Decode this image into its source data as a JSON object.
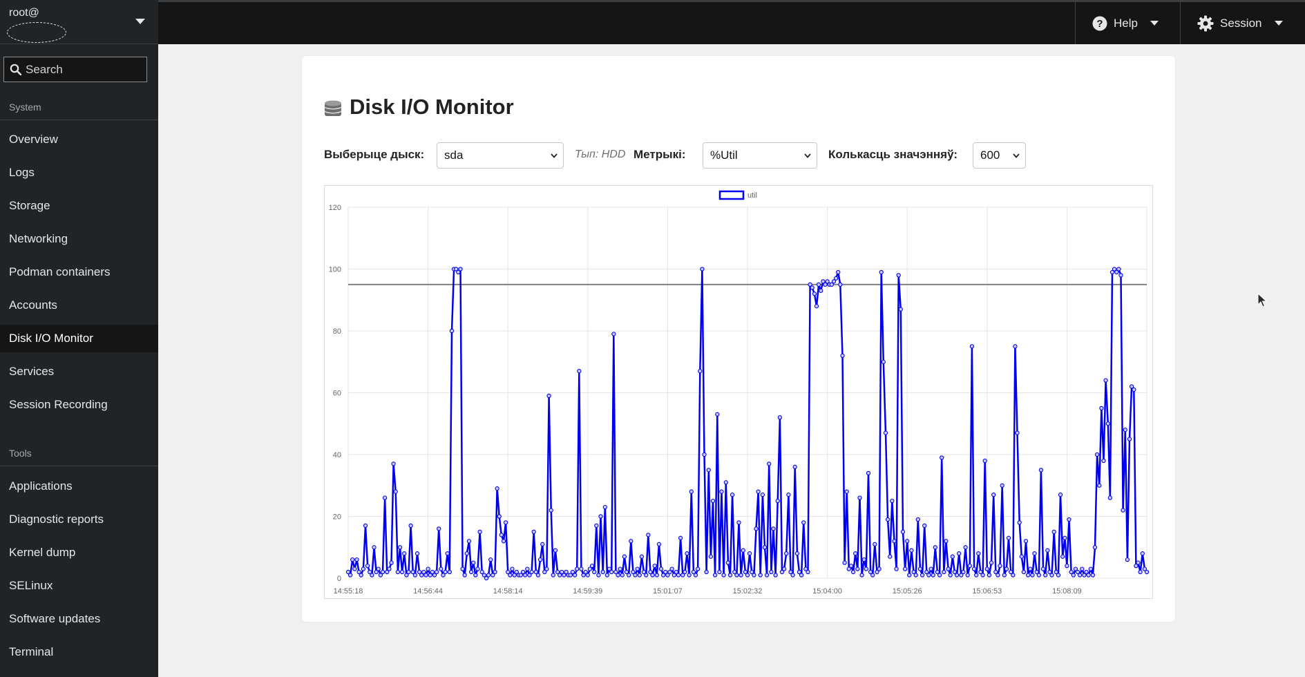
{
  "user": {
    "name": "root@"
  },
  "search": {
    "placeholder": "Search"
  },
  "topbar": {
    "help_label": "Help",
    "session_label": "Session"
  },
  "sidebar": {
    "system_title": "System",
    "system_items": [
      {
        "label": "Overview"
      },
      {
        "label": "Logs"
      },
      {
        "label": "Storage"
      },
      {
        "label": "Networking"
      },
      {
        "label": "Podman containers"
      },
      {
        "label": "Accounts"
      },
      {
        "label": "Disk I/O Monitor",
        "active": true
      },
      {
        "label": "Services"
      },
      {
        "label": "Session Recording"
      }
    ],
    "tools_title": "Tools",
    "tools_items": [
      {
        "label": "Applications"
      },
      {
        "label": "Diagnostic reports"
      },
      {
        "label": "Kernel dump"
      },
      {
        "label": "SELinux"
      },
      {
        "label": "Software updates"
      },
      {
        "label": "Terminal"
      }
    ]
  },
  "page": {
    "title": "Disk I/O Monitor",
    "disk_label": "Выберыце дыск:",
    "disk_value": "sda",
    "disk_type": "Тып: HDD",
    "metric_label": "Метрыкі:",
    "metric_value": "%Util",
    "count_label": "Колькасць значэнняў:",
    "count_value": "600"
  },
  "colors": {
    "line": "#0000ee",
    "threshold": "#808080",
    "topbar": "#151515",
    "sidebar": "#212427"
  },
  "chart_data": {
    "type": "line",
    "legend": [
      "util"
    ],
    "legend_position": "top",
    "ylim": [
      0,
      120
    ],
    "yticks": [
      0,
      20,
      40,
      60,
      80,
      100,
      120
    ],
    "xticks": [
      "14:55:18",
      "14:56:44",
      "14:58:14",
      "14:59:39",
      "15:01:07",
      "15:02:32",
      "15:04:00",
      "15:05:26",
      "15:06:53",
      "15:08:09"
    ],
    "threshold": 95,
    "grid": true,
    "series": [
      {
        "name": "util",
        "values": [
          2,
          1,
          6,
          3,
          6,
          2,
          1,
          3,
          17,
          4,
          2,
          1,
          10,
          2,
          3,
          1,
          2,
          26,
          2,
          3,
          5,
          37,
          28,
          2,
          10,
          2,
          8,
          1,
          2,
          17,
          2,
          1,
          8,
          2,
          1,
          2,
          1,
          3,
          1,
          2,
          1,
          2,
          16,
          3,
          1,
          2,
          8,
          2,
          80,
          100,
          100,
          99,
          100,
          3,
          1,
          8,
          12,
          2,
          5,
          1,
          3,
          15,
          2,
          1,
          0,
          1,
          6,
          1,
          2,
          29,
          20,
          14,
          12,
          18,
          2,
          1,
          3,
          1,
          2,
          1,
          1,
          2,
          1,
          3,
          1,
          2,
          15,
          2,
          1,
          6,
          11,
          2,
          3,
          59,
          22,
          1,
          9,
          2,
          1,
          2,
          1,
          2,
          1,
          1,
          2,
          1,
          3,
          67,
          3,
          1,
          2,
          1,
          3,
          4,
          2,
          17,
          1,
          20,
          2,
          23,
          1,
          3,
          2,
          79,
          2,
          1,
          3,
          1,
          7,
          2,
          1,
          12,
          2,
          1,
          3,
          1,
          7,
          2,
          1,
          14,
          2,
          1,
          4,
          1,
          11,
          3,
          1,
          2,
          1,
          2,
          3,
          1,
          2,
          1,
          13,
          1,
          2,
          8,
          1,
          28,
          2,
          1,
          3,
          67,
          100,
          40,
          2,
          35,
          7,
          25,
          1,
          53,
          2,
          28,
          1,
          31,
          5,
          1,
          27,
          2,
          1,
          18,
          1,
          9,
          2,
          1,
          8,
          2,
          1,
          16,
          28,
          1,
          27,
          10,
          1,
          37,
          2,
          16,
          1,
          25,
          52,
          2,
          3,
          8,
          27,
          2,
          1,
          36,
          8,
          2,
          1,
          18,
          3,
          2,
          95,
          94,
          92,
          88,
          95,
          93,
          96,
          95,
          96,
          95,
          95,
          96,
          97,
          99,
          95,
          72,
          5,
          28,
          3,
          4,
          2,
          8,
          3,
          26,
          1,
          6,
          3,
          34,
          2,
          1,
          11,
          2,
          3,
          99,
          70,
          47,
          19,
          7,
          25,
          12,
          3,
          98,
          87,
          15,
          3,
          12,
          1,
          9,
          2,
          1,
          19,
          3,
          1,
          17,
          2,
          1,
          3,
          1,
          10,
          2,
          1,
          39,
          2,
          12,
          3,
          1,
          7,
          2,
          1,
          8,
          1,
          2,
          10,
          1,
          4,
          75,
          3,
          1,
          8,
          2,
          1,
          38,
          3,
          1,
          5,
          27,
          2,
          1,
          4,
          30,
          1,
          3,
          13,
          2,
          1,
          75,
          47,
          18,
          7,
          2,
          12,
          1,
          3,
          1,
          8,
          2,
          1,
          35,
          3,
          1,
          9,
          2,
          1,
          15,
          2,
          1,
          27,
          7,
          13,
          4,
          19,
          2,
          1,
          3,
          2,
          1,
          3,
          1,
          2,
          1,
          3,
          1,
          10,
          40,
          30,
          55,
          38,
          64,
          50,
          26,
          99,
          100,
          99,
          100,
          98,
          22,
          48,
          6,
          45,
          62,
          61,
          4,
          5,
          2,
          8,
          3,
          2
        ]
      }
    ]
  }
}
